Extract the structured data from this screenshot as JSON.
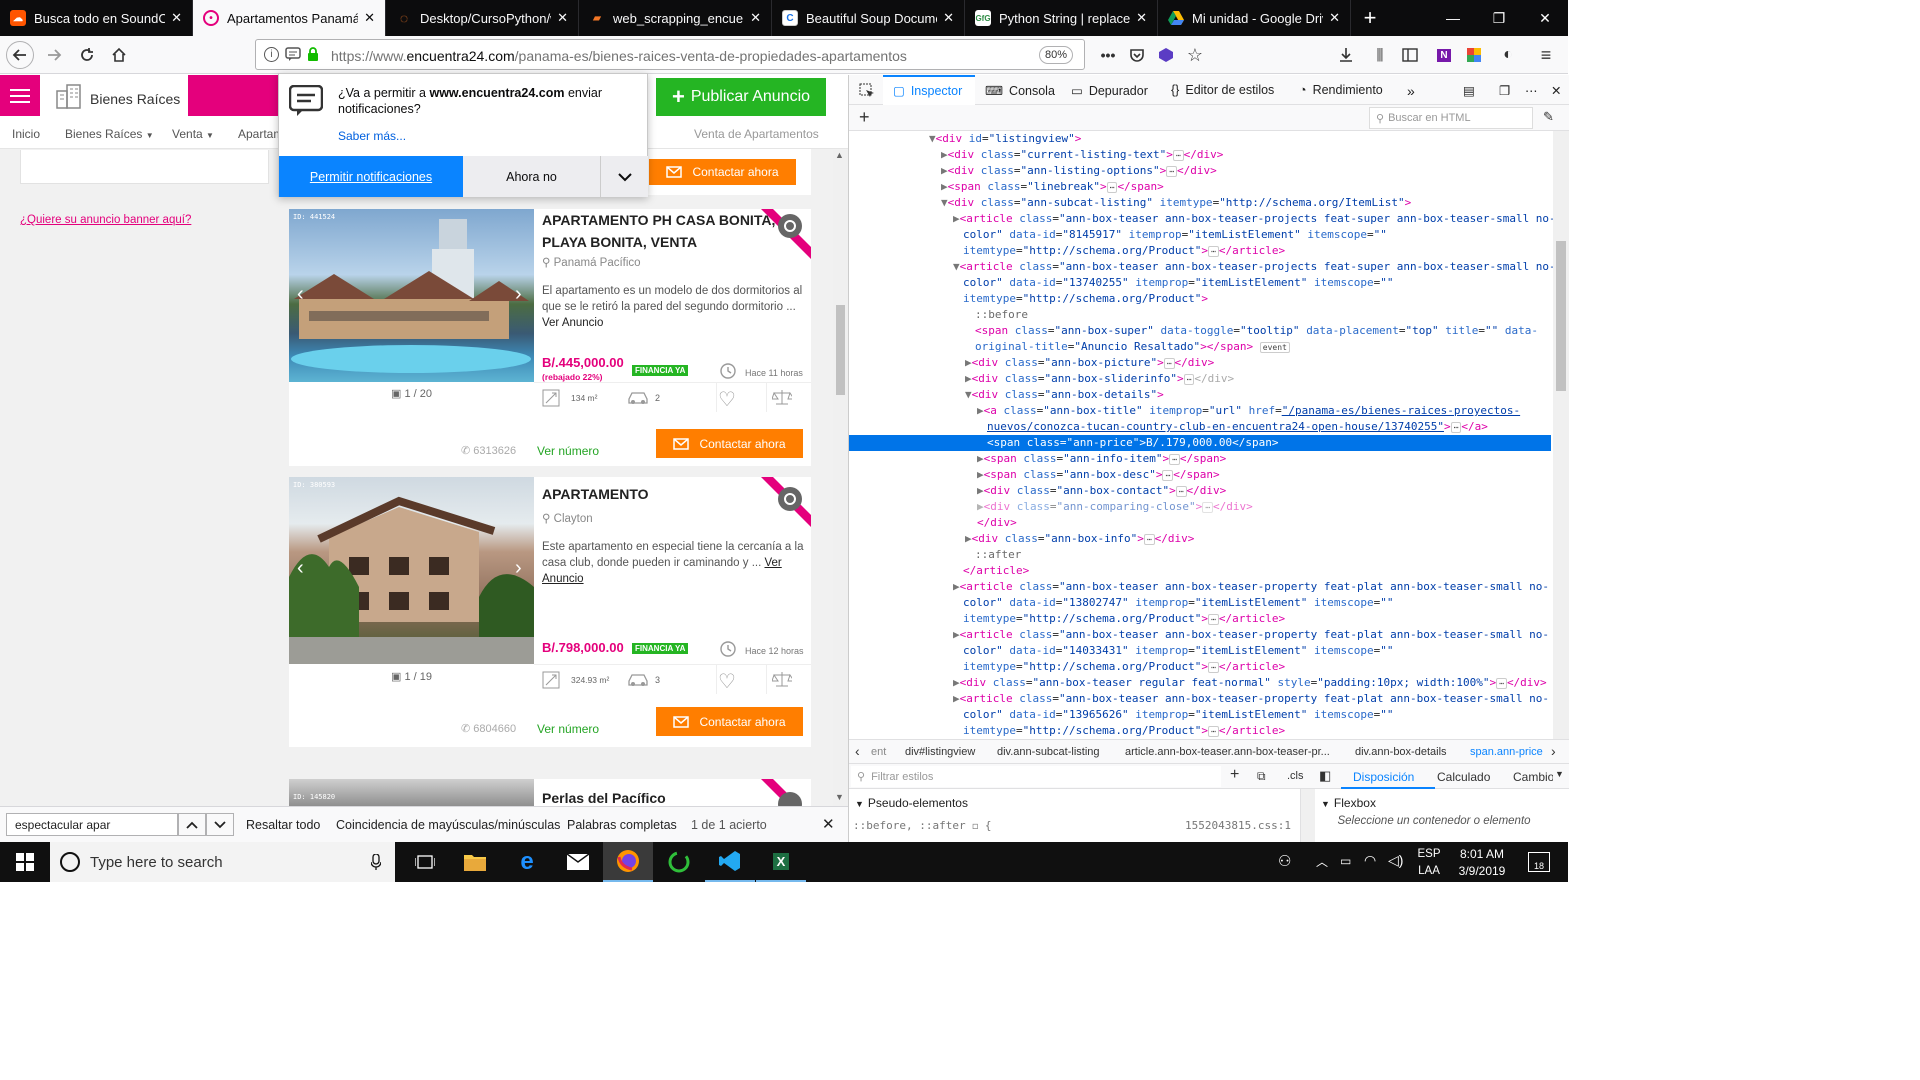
{
  "tabs": [
    {
      "label": "Busca todo en SoundCl",
      "icon": "soundcloud-icon",
      "active": false
    },
    {
      "label": "Apartamentos Panamá |",
      "icon": "encuentra24-icon",
      "active": true
    },
    {
      "label": "Desktop/CursoPython/w",
      "icon": "jupyter-icon",
      "active": false
    },
    {
      "label": "web_scrapping_encuent",
      "icon": "notebook-icon",
      "active": false
    },
    {
      "label": "Beautiful Soup Docume",
      "icon": "crummy-icon",
      "active": false
    },
    {
      "label": "Python String | replace()",
      "icon": "gfg-icon",
      "active": false
    },
    {
      "label": "Mi unidad - Google Driv",
      "icon": "google-drive-icon",
      "active": false
    }
  ],
  "url": {
    "prefix": "https://www.",
    "domain": "encuentra24.com",
    "path": "/panama-es/bienes-raices-venta-de-propiedades-apartamentos"
  },
  "zoom": "80%",
  "site": {
    "section": "Bienes Raíces",
    "publish_button": "Publicar Anuncio",
    "subnav": [
      "Inicio",
      "Bienes Raíces",
      "Venta",
      "Apartam"
    ],
    "breadcrumb_right": "Venta de Apartamentos",
    "banner_link": "¿Quiere su anuncio banner aquí?",
    "contact_top": "Contactar ahora"
  },
  "notification": {
    "question_pre": "¿Va a permitir a ",
    "question_domain": "www.encuentra24.com",
    "question_post": " enviar notificaciones?",
    "learn_more": "Saber más...",
    "allow": "Permitir notificaciones",
    "deny": "Ahora no"
  },
  "listings": [
    {
      "id": "ID: 441524",
      "title_line1": "APARTAMENTO PH CASA BONITA,",
      "title_line2": "PLAYA BONITA, VENTA",
      "location": "Panamá Pacífico",
      "desc": "El apartamento es un modelo de dos dormitorios al que se le retiró la pared del segundo dormitorio ...",
      "desc_link": "Ver Anuncio",
      "price": "B/.445,000.00",
      "rebate": "(rebajado 22%)",
      "finance": "FINANCIA YA",
      "time": "Hace 11 horas",
      "photos": "1 / 20",
      "area": "134 m²",
      "parking": "2",
      "phone": "6313626",
      "see_number": "Ver número",
      "contact": "Contactar ahora"
    },
    {
      "id": "ID: 380593",
      "title_line1": "APARTAMENTO",
      "title_line2": "",
      "location": "Clayton",
      "desc": "Este apartamento en especial tiene la cercanía a la casa club, donde pueden ir caminando y ...",
      "desc_link": "Ver Anuncio",
      "price": "B/.798,000.00",
      "rebate": "",
      "finance": "FINANCIA YA",
      "time": "Hace 12 horas",
      "photos": "1 / 19",
      "area": "324.93 m²",
      "parking": "3",
      "phone": "6804660",
      "see_number": "Ver número",
      "contact": "Contactar ahora"
    },
    {
      "id": "ID: 145820",
      "title_line1": "Perlas del Pacífico"
    }
  ],
  "devtools": {
    "tabs": [
      "Inspector",
      "Consola",
      "Depurador",
      "Editor de estilos",
      "Rendimiento"
    ],
    "search_placeholder": "Buscar en HTML",
    "breadcrumbs": [
      "ent",
      "div#listingview",
      "div.ann-subcat-listing",
      "article.ann-box-teaser.ann-box-teaser-pr...",
      "div.ann-box-details",
      "span.ann-price"
    ],
    "filter_placeholder": "Filtrar estilos",
    "cls": ".cls",
    "layout_tabs": [
      "Disposición",
      "Calculado",
      "Cambio"
    ],
    "pseudo_title": "Pseudo-elementos",
    "pseudo_rule": "::before, ::after",
    "pseudo_source": "1552043815.css:1",
    "flexbox_title": "Flexbox",
    "flexbox_hint": "Seleccione un contenedor o elemento"
  },
  "findbar": {
    "query": "espectacular apar",
    "highlight_all": "Resaltar todo",
    "match_case": "Coincidencia de mayúsculas/minúsculas",
    "whole_words": "Palabras completas",
    "result": "1 de 1 acierto"
  },
  "taskbar": {
    "search_placeholder": "Type here to search",
    "lang1": "ESP",
    "lang2": "LAA",
    "time": "8:01 AM",
    "date": "3/9/2019",
    "notifications": "18"
  }
}
